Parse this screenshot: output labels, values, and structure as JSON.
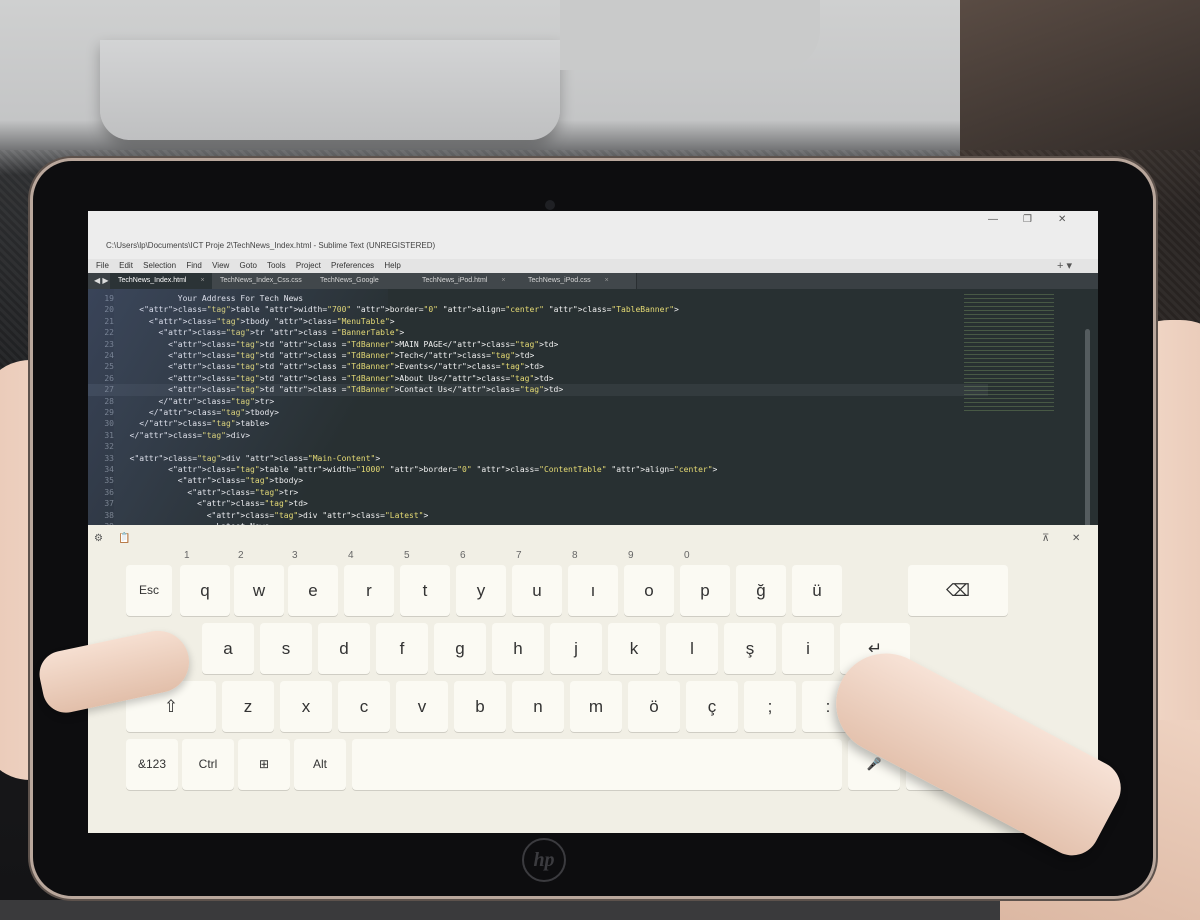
{
  "window": {
    "title": "C:\\Users\\lp\\Documents\\ICT Proje 2\\TechNews_Index.html - Sublime Text (UNREGISTERED)",
    "minimize": "—",
    "restore": "❐",
    "close": "✕"
  },
  "menu": [
    "File",
    "Edit",
    "Selection",
    "Find",
    "View",
    "Goto",
    "Tools",
    "Project",
    "Preferences",
    "Help"
  ],
  "tabbar": {
    "nav": "◀ ▶",
    "new_tab": "+ ▾",
    "tabs": [
      {
        "label": "TechNews_Index.html",
        "close": "×"
      },
      {
        "label": "TechNews_Index_Css.css",
        "close": "×"
      },
      {
        "label": "TechNews_Google IO.html",
        "close": "×"
      },
      {
        "label": "TechNews_iPod.html",
        "close": "×"
      },
      {
        "label": "TechNews_iPod.css",
        "close": "×"
      }
    ]
  },
  "editor": {
    "lines": [
      {
        "n": "19",
        "t1": "            Your Address For Tech News"
      },
      {
        "n": "20",
        "t1": "    <table width=\"700\" border=\"0\" align=\"center\" class=\"TableBanner\">"
      },
      {
        "n": "21",
        "t1": "      <tbody class=\"MenuTable\">"
      },
      {
        "n": "22",
        "t1": "        <tr class =\"BannerTable\">"
      },
      {
        "n": "23",
        "t1": "          <td class =\"TdBanner\">MAIN PAGE</td>"
      },
      {
        "n": "24",
        "t1": "          <td class =\"TdBanner\">Tech</td>"
      },
      {
        "n": "25",
        "t1": "          <td class =\"TdBanner\">Events</td>"
      },
      {
        "n": "26",
        "t1": "          <td class =\"TdBanner\">About Us</td>"
      },
      {
        "n": "27",
        "t1": "          <td class =\"TdBanner\">Contact Us</td>"
      },
      {
        "n": "28",
        "t1": "        </tr>"
      },
      {
        "n": "29",
        "t1": "      </tbody>"
      },
      {
        "n": "30",
        "t1": "    </table>"
      },
      {
        "n": "31",
        "t1": "  </div>"
      },
      {
        "n": "32",
        "t1": ""
      },
      {
        "n": "33",
        "t1": "  <div class=\"Main-Content\">"
      },
      {
        "n": "34",
        "t1": "          <table width=\"1000\" border=\"0\" class=\"ContentTable\" align=\"center\">"
      },
      {
        "n": "35",
        "t1": "            <tbody>"
      },
      {
        "n": "36",
        "t1": "              <tr>"
      },
      {
        "n": "37",
        "t1": "                <td>"
      },
      {
        "n": "38",
        "t1": "                  <div class=\"Latest\">"
      },
      {
        "n": "39",
        "t1": "                    Latest News"
      }
    ]
  },
  "keyboard": {
    "settings_icon": "⚙",
    "clipboard_icon": "📋",
    "dock_icon": "⊼",
    "close_icon": "✕",
    "row1": [
      {
        "k": "Esc",
        "h": ""
      },
      {
        "k": "q",
        "h": "1"
      },
      {
        "k": "w",
        "h": "2"
      },
      {
        "k": "e",
        "h": "3"
      },
      {
        "k": "r",
        "h": "4"
      },
      {
        "k": "t",
        "h": "5"
      },
      {
        "k": "y",
        "h": "6"
      },
      {
        "k": "u",
        "h": "7"
      },
      {
        "k": "ı",
        "h": "8"
      },
      {
        "k": "o",
        "h": "9"
      },
      {
        "k": "p",
        "h": "0"
      },
      {
        "k": "ğ",
        "h": ""
      },
      {
        "k": "ü",
        "h": ""
      },
      {
        "k": "⌫",
        "h": ""
      }
    ],
    "row2": [
      "a",
      "s",
      "d",
      "f",
      "g",
      "h",
      "j",
      "k",
      "l",
      "ş",
      "i",
      "↵"
    ],
    "row3": [
      "⇧",
      "z",
      "x",
      "c",
      "v",
      "b",
      "n",
      "m",
      "ö",
      "ç",
      ";",
      ":"
    ],
    "row3_sub": [
      ",",
      "."
    ],
    "row4": {
      "sym": "&123",
      "ctrl": "Ctrl",
      "win": "⊞",
      "alt": "Alt",
      "mic": "🎤",
      "left": "<"
    }
  },
  "device": {
    "brand": "hp"
  }
}
